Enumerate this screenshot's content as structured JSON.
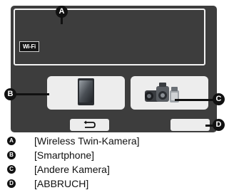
{
  "screen": {
    "wifi_badge": "Wi-Fi",
    "icons": {
      "smartphone": "smartphone-icon",
      "camera": "camera-icon",
      "back": "return-arrow-icon"
    }
  },
  "markers": {
    "a": "A",
    "b": "B",
    "c": "C",
    "d": "D"
  },
  "legend": [
    {
      "marker": "A",
      "text": "[Wireless Twin-Kamera]"
    },
    {
      "marker": "B",
      "text": "[Smartphone]"
    },
    {
      "marker": "C",
      "text": "[Andere Kamera]"
    },
    {
      "marker": "D",
      "text": "[ABBRUCH]"
    }
  ],
  "colors": {
    "screen_bg": "#3d3d3d",
    "tile_bg": "#ededed",
    "marker_bg": "#111111"
  }
}
